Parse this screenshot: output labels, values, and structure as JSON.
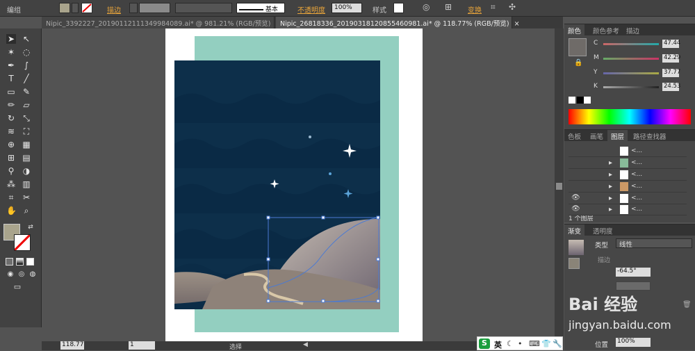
{
  "control_bar": {
    "selection": "编组",
    "stroke_label": "描边",
    "stroke_style": "基本",
    "opacity_label": "不透明度",
    "opacity_value": "100%",
    "style_label": "样式",
    "transform_label": "变换"
  },
  "doc_tabs": [
    "Nipic_3392227_20190112111349984089.ai* @ 981.21% (RGB/预览)",
    "Nipic_26818336_20190318120855460981.ai* @ 118.77% (RGB/预览)"
  ],
  "status": {
    "zoom": "118.77",
    "page": "1",
    "tool": "选择"
  },
  "color_panel": {
    "tabs": [
      "颜色",
      "颜色参考",
      "描边"
    ],
    "channels": [
      {
        "name": "C",
        "value": "47.44"
      },
      {
        "name": "M",
        "value": "42.29"
      },
      {
        "name": "Y",
        "value": "37.77"
      },
      {
        "name": "K",
        "value": "24.53"
      }
    ]
  },
  "layers_panel": {
    "tabs": [
      "色板",
      "画笔",
      "图层",
      "路径查找器"
    ],
    "rows": [
      "<...",
      "<...",
      "<...",
      "<...",
      "<...",
      "<..."
    ],
    "footer": "1 个图层"
  },
  "gradient_panel": {
    "tabs": [
      "渐变",
      "透明度"
    ],
    "type_label": "类型",
    "type_value": "线性",
    "stroke_label": "描边",
    "angle": "-64.5°",
    "position_label": "位置",
    "position_value": "100%"
  },
  "watermark": {
    "line1": "Bai 经验",
    "line2": "jingyan.baidu.com"
  },
  "ime": {
    "lang": "英"
  },
  "colors": {
    "sky": "#0a2a45",
    "mint": "#93cfc0",
    "sand": "#9a8e84"
  }
}
